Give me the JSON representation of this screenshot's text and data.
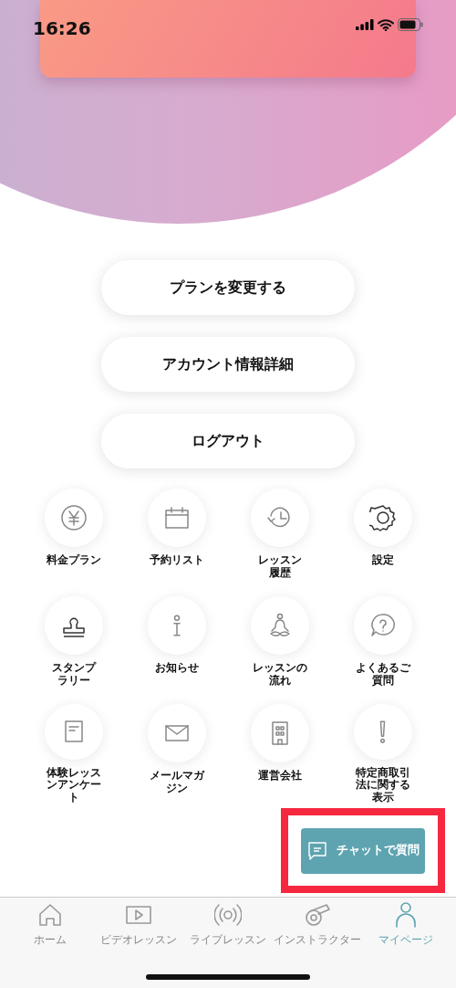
{
  "status_bar": {
    "time": "16:26"
  },
  "actions": [
    "プランを変更する",
    "アカウント情報詳細",
    "ログアウト"
  ],
  "menu": [
    {
      "label": "料金プラン"
    },
    {
      "label": "予約リスト"
    },
    {
      "label": "レッスン履歴"
    },
    {
      "label": "設定"
    },
    {
      "label": "スタンプラリー"
    },
    {
      "label": "お知らせ"
    },
    {
      "label": "レッスンの流れ"
    },
    {
      "label": "よくあるご質問"
    },
    {
      "label": "体験レッスンアンケート"
    },
    {
      "label": "メールマガジン"
    },
    {
      "label": "運営会社"
    },
    {
      "label": "特定商取引法に関する表示"
    }
  ],
  "chat_button": {
    "label": "チャットで質問",
    "highlighted": true
  },
  "tab_bar": [
    {
      "label": "ホーム",
      "selected": false
    },
    {
      "label": "ビデオレッスン",
      "selected": false
    },
    {
      "label": "ライブレッスン",
      "selected": false
    },
    {
      "label": "インストラクター",
      "selected": false
    },
    {
      "label": "マイページ",
      "selected": true
    }
  ]
}
